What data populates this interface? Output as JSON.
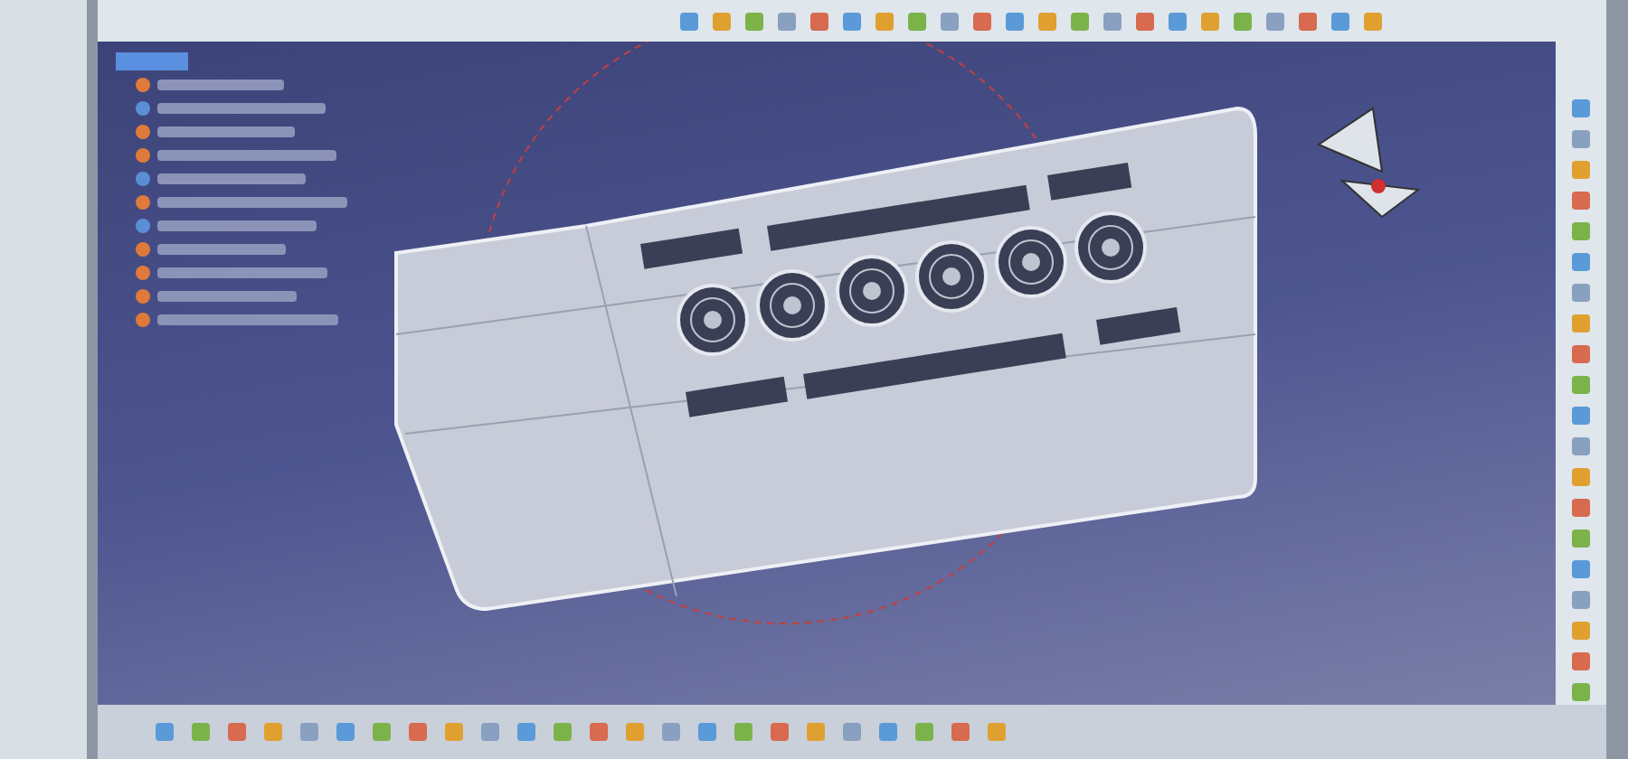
{
  "spec_tree": {
    "root": {
      "selected": true
    },
    "children": [
      {
        "kind": "part"
      },
      {
        "kind": "link"
      },
      {
        "kind": "part"
      },
      {
        "kind": "part"
      },
      {
        "kind": "link"
      },
      {
        "kind": "part"
      },
      {
        "kind": "link"
      },
      {
        "kind": "part"
      },
      {
        "kind": "part"
      },
      {
        "kind": "part"
      },
      {
        "kind": "part"
      }
    ]
  }
}
